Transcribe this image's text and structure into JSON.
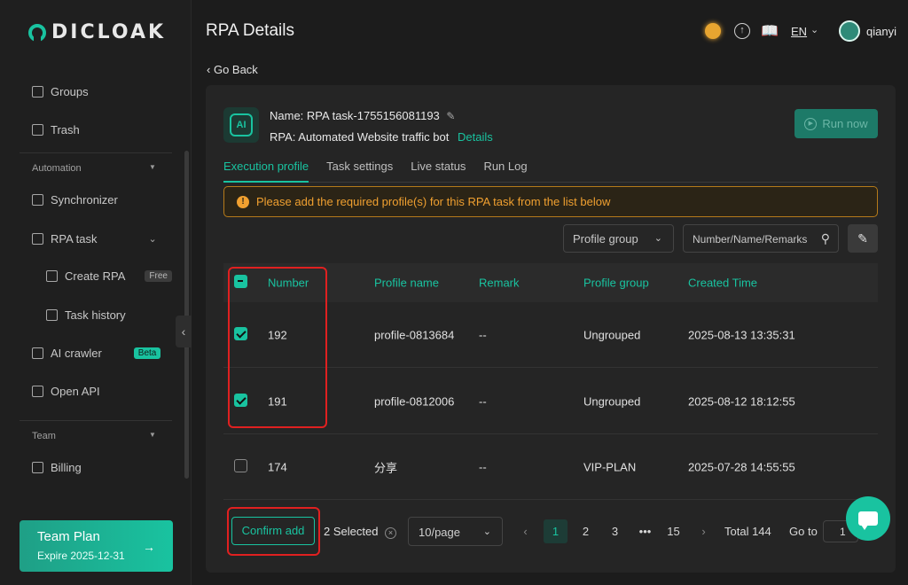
{
  "app": {
    "logo_text": "DICLOAK"
  },
  "sidebar": {
    "items": [
      {
        "label": "Groups",
        "icon": "groups-icon"
      },
      {
        "label": "Trash",
        "icon": "trash-icon"
      }
    ],
    "automation_label": "Automation",
    "automation_items": [
      {
        "label": "Synchronizer",
        "icon": "sync-icon"
      },
      {
        "label": "RPA task",
        "icon": "robot-icon"
      },
      {
        "label": "Create RPA",
        "icon": "store-icon",
        "badge": "Free"
      },
      {
        "label": "Task history",
        "icon": "doc-icon"
      },
      {
        "label": "AI crawler",
        "icon": "bug-icon",
        "badge": "Beta"
      },
      {
        "label": "Open API",
        "icon": "api-icon"
      }
    ],
    "team_label": "Team",
    "team_items": [
      {
        "label": "Billing",
        "icon": "billing-icon"
      }
    ],
    "plan": {
      "title": "Team Plan",
      "expire": "Expire 2025-12-31"
    }
  },
  "header": {
    "title": "RPA Details",
    "language": "EN",
    "username": "qianyi"
  },
  "go_back": "Go Back",
  "task": {
    "name_label": "Name:",
    "name": "RPA task-1755156081193",
    "rpa_label": "RPA:",
    "rpa": "Automated Website traffic bot",
    "details_link": "Details",
    "run_label": "Run now",
    "ai_badge": "AI"
  },
  "tabs": [
    "Execution profile",
    "Task settings",
    "Live status",
    "Run Log"
  ],
  "alert": "Please add the required profile(s) for this RPA task from the list below",
  "filters": {
    "group_placeholder": "Profile group",
    "search_placeholder": "Number/Name/Remarks"
  },
  "table": {
    "columns": [
      "Number",
      "Profile name",
      "Remark",
      "Profile group",
      "Created Time"
    ],
    "rows": [
      {
        "number": "192",
        "name": "profile-0813684",
        "remark": "--",
        "group": "Ungrouped",
        "created": "2025-08-13 13:35:31",
        "checked": true
      },
      {
        "number": "191",
        "name": "profile-0812006",
        "remark": "--",
        "group": "Ungrouped",
        "created": "2025-08-12 18:12:55",
        "checked": true
      },
      {
        "number": "174",
        "name": "分享",
        "remark": "--",
        "group": "VIP-PLAN",
        "created": "2025-07-28 14:55:55",
        "checked": false
      }
    ]
  },
  "footer": {
    "confirm_label": "Confirm add",
    "selected": "2 Selected",
    "page_size": "10/page",
    "pages": [
      "1",
      "2",
      "3",
      "•••",
      "15"
    ],
    "total": "Total 144",
    "goto_label": "Go to",
    "goto_value": "1"
  },
  "colors": {
    "accent": "#19c3a0",
    "warning": "#f0a030",
    "highlight": "#e02020"
  }
}
